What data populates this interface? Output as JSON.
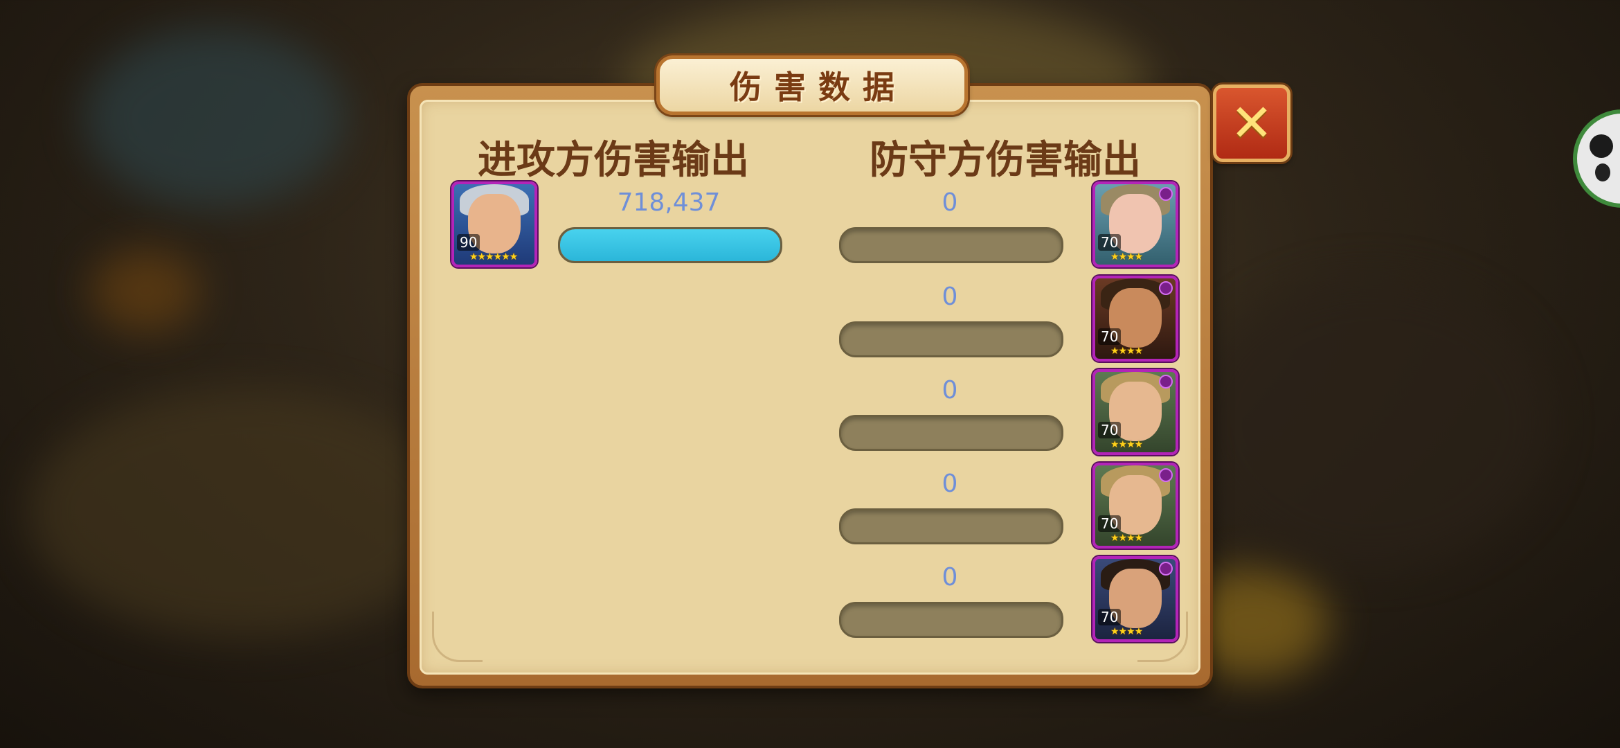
{
  "dialog": {
    "title": "伤害数据",
    "close_icon": "close-icon"
  },
  "attacker": {
    "heading": "进攻方伤害输出",
    "heroes": [
      {
        "level": "90",
        "stars": 6,
        "damage": "718,437",
        "bar_fill": 1.0
      }
    ]
  },
  "defender": {
    "heading": "防守方伤害输出",
    "heroes": [
      {
        "level": "70",
        "stars": 4,
        "damage": "0",
        "bar_fill": 0
      },
      {
        "level": "70",
        "stars": 4,
        "damage": "0",
        "bar_fill": 0
      },
      {
        "level": "70",
        "stars": 4,
        "damage": "0",
        "bar_fill": 0
      },
      {
        "level": "70",
        "stars": 4,
        "damage": "0",
        "bar_fill": 0
      },
      {
        "level": "70",
        "stars": 4,
        "damage": "0",
        "bar_fill": 0
      }
    ]
  },
  "colors": {
    "bar_fill": "#2bb6d9",
    "bar_empty": "#8e805c",
    "damage_text": "#6f8fd8",
    "heading_text": "#6b3a17",
    "portrait_border": "#b324b8"
  }
}
